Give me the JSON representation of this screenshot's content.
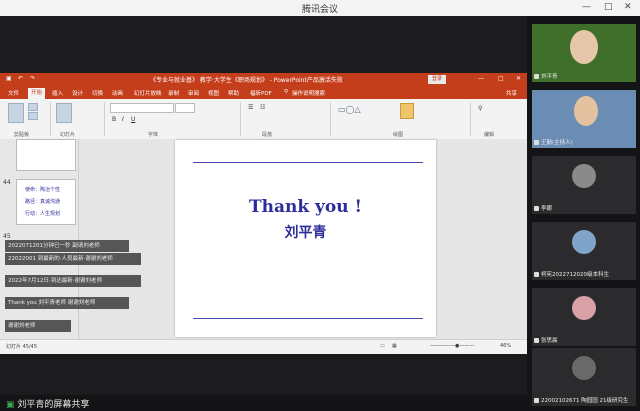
{
  "window": {
    "title": "腾讯会议"
  },
  "ppt": {
    "title": "《专业与就业基》 教学·大学生《职场规划》 - PowerPoint产品激活失败",
    "login_label": "登录",
    "tabs": [
      "文件",
      "开始",
      "插入",
      "设计",
      "切换",
      "动画",
      "幻灯片放映",
      "录制",
      "审阅",
      "视图",
      "帮助",
      "福昕PDF",
      "操作说明搜索"
    ],
    "active_tab": "开始",
    "share_label": "共享",
    "ribbon_groups": [
      "剪贴板",
      "幻灯片",
      "字体",
      "段落",
      "绘图",
      "编辑"
    ],
    "slide_numbers": [
      "44",
      "45"
    ],
    "thumb_lines": [
      "使命：陶冶个性",
      "路径：真诚沟通",
      "行动：人生规划"
    ],
    "slide": {
      "thanks": "Thank you !",
      "name": "刘平青"
    },
    "status_left": "幻灯片 45/45",
    "status_right": "46%"
  },
  "chat": [
    {
      "user": "",
      "text": "2022071201分钟已一秒 副请刘老师"
    },
    {
      "user": "",
      "text": "22022001 到最新的·人员最新·谢谢刘老师"
    },
    {
      "user": "",
      "text": "2022年7月12日·到达最新·谢谢刘老师"
    },
    {
      "user": "",
      "text": "Thank you 刘平青老师 谢谢刘老师"
    },
    {
      "user": "",
      "text": "谢谢刘老师"
    }
  ],
  "gallery": [
    {
      "name": "刘平青"
    },
    {
      "name": "王勤(主持人)"
    },
    {
      "name": "李娜"
    },
    {
      "name": "柯宪2022712020级本科生"
    },
    {
      "name": "张思晨"
    },
    {
      "name": "22002102671 陶园园 21级研究生"
    }
  ],
  "bottom": {
    "share_text": "刘平青的屏幕共享"
  }
}
